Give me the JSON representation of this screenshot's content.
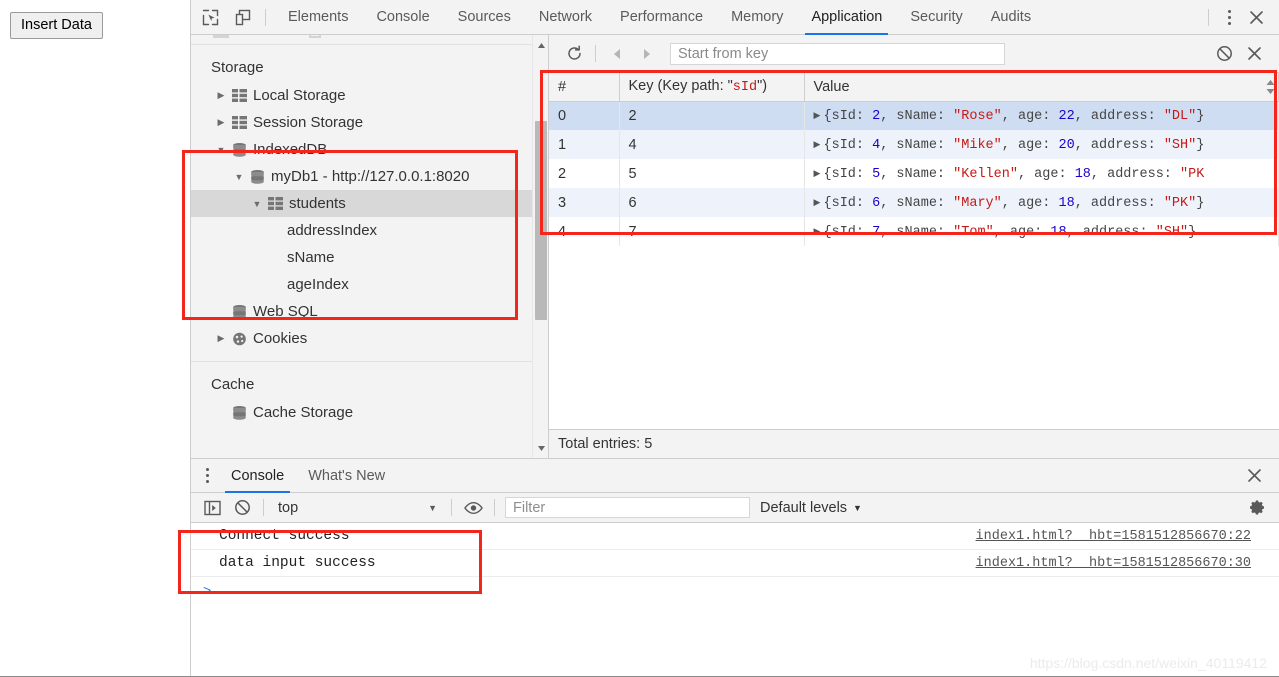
{
  "page": {
    "insert_button_label": "Insert Data",
    "watermark": "https://blog.csdn.net/weixin_40119412"
  },
  "devtools": {
    "toolbar_icons": [
      "inspect-element-icon",
      "device-toolbar-icon",
      "more-options-icon",
      "close-icon"
    ],
    "tabs": [
      {
        "label": "Elements",
        "active": false
      },
      {
        "label": "Console",
        "active": false
      },
      {
        "label": "Sources",
        "active": false
      },
      {
        "label": "Network",
        "active": false
      },
      {
        "label": "Performance",
        "active": false
      },
      {
        "label": "Memory",
        "active": false
      },
      {
        "label": "Application",
        "active": true
      },
      {
        "label": "Security",
        "active": false
      },
      {
        "label": "Audits",
        "active": false
      }
    ],
    "accent_color": "#1a73e8"
  },
  "sidebar": {
    "sections": [
      {
        "title": "Storage"
      },
      {
        "title": "Cache"
      }
    ],
    "storage_items": [
      {
        "label": "Local Storage",
        "icon": "table-icon",
        "arrow": "collapsed",
        "indent": 0,
        "selected": false
      },
      {
        "label": "Session Storage",
        "icon": "table-icon",
        "arrow": "collapsed",
        "indent": 0,
        "selected": false
      },
      {
        "label": "IndexedDB",
        "icon": "database-icon",
        "arrow": "expanded",
        "indent": 0,
        "selected": false
      },
      {
        "label": "myDb1 - http://127.0.0.1:8020",
        "icon": "database-icon",
        "arrow": "expanded",
        "indent": 1,
        "selected": false
      },
      {
        "label": "students",
        "icon": "table-icon",
        "arrow": "expanded",
        "indent": 2,
        "selected": true
      },
      {
        "label": "addressIndex",
        "icon": "none",
        "arrow": "none",
        "indent": 3,
        "selected": false
      },
      {
        "label": "sName",
        "icon": "none",
        "arrow": "none",
        "indent": 3,
        "selected": false
      },
      {
        "label": "ageIndex",
        "icon": "none",
        "arrow": "none",
        "indent": 3,
        "selected": false
      },
      {
        "label": "Web SQL",
        "icon": "database-icon",
        "arrow": "none",
        "indent": 0,
        "selected": false
      },
      {
        "label": "Cookies",
        "icon": "cookie-icon",
        "arrow": "collapsed",
        "indent": 0,
        "selected": false
      }
    ],
    "cache_items": [
      {
        "label": "Cache Storage",
        "icon": "database-icon",
        "arrow": "none",
        "indent": 0,
        "selected": false
      }
    ]
  },
  "dataview": {
    "toolbar": {
      "refresh_icon": "refresh-icon",
      "prev_icon": "previous-page-icon",
      "next_icon": "next-page-icon",
      "key_input_placeholder": "Start from key",
      "key_input_value": "",
      "clear_icon": "clear-object-store-icon",
      "delete_icon": "delete-selected-icon"
    },
    "columns": [
      "#",
      "Key (Key path: \"sId\")",
      "Value"
    ],
    "key_path_name": "sId",
    "rows": [
      {
        "index": "0",
        "key": "2",
        "value_text": "{sId: 2, sName: \"Rose\", age: 22, address: \"DL\"}",
        "sId": "2",
        "sName": "Rose",
        "age": "22",
        "address": "DL",
        "truncated": false,
        "selected": true
      },
      {
        "index": "1",
        "key": "4",
        "value_text": "{sId: 4, sName: \"Mike\", age: 20, address: \"SH\"}",
        "sId": "4",
        "sName": "Mike",
        "age": "20",
        "address": "SH",
        "truncated": false,
        "selected": false
      },
      {
        "index": "2",
        "key": "5",
        "value_text": "{sId: 5, sName: \"Kellen\", age: 18, address: \"PK",
        "sId": "5",
        "sName": "Kellen",
        "age": "18",
        "address": "PK",
        "truncated": true,
        "selected": false
      },
      {
        "index": "3",
        "key": "6",
        "value_text": "{sId: 6, sName: \"Mary\", age: 18, address: \"PK\"}",
        "sId": "6",
        "sName": "Mary",
        "age": "18",
        "address": "PK",
        "truncated": false,
        "selected": false
      },
      {
        "index": "4",
        "key": "7",
        "value_text": "{sId: 7, sName: \"Tom\", age: 18, address: \"SH\"}",
        "sId": "7",
        "sName": "Tom",
        "age": "18",
        "address": "SH",
        "truncated": false,
        "selected": false
      }
    ],
    "footer_text": "Total entries: 5"
  },
  "console_drawer": {
    "tabs": [
      {
        "label": "Console",
        "active": true
      },
      {
        "label": "What's New",
        "active": false
      }
    ],
    "toolbar": {
      "sidebar_icon": "console-sidebar-icon",
      "clear_icon": "clear-console-icon",
      "context": "top",
      "eye_icon": "live-expression-icon",
      "filter_placeholder": "Filter",
      "filter_value": "",
      "levels": "Default levels",
      "settings_icon": "gear-icon"
    },
    "messages": [
      {
        "text": "Connect success",
        "source": "index1.html?__hbt=1581512856670:22"
      },
      {
        "text": "data input success",
        "source": "index1.html?__hbt=1581512856670:30"
      }
    ],
    "prompt_symbol": ">"
  },
  "annotations": {
    "color": "#f4251b",
    "boxes": [
      "indexeddb-tree-highlight",
      "data-table-highlight",
      "console-messages-highlight"
    ]
  }
}
